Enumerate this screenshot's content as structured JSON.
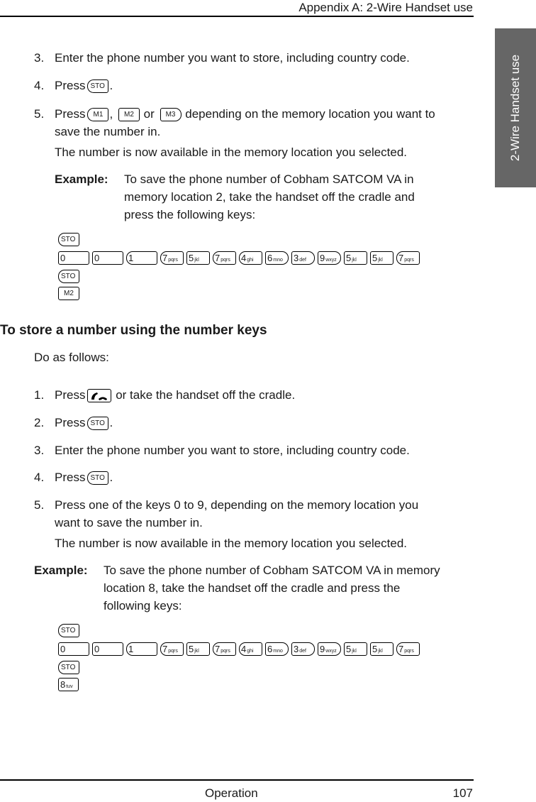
{
  "header": {
    "title": "Appendix A:  2-Wire Handset use"
  },
  "side_tab": {
    "label": "2-Wire Handset use",
    "color": "#666666"
  },
  "section1": {
    "steps": [
      {
        "num": "3.",
        "text": "Enter the phone number you want to store, including country code."
      },
      {
        "num": "4.",
        "pre": "Press",
        "post": "."
      },
      {
        "num": "5.",
        "pre": "Press",
        "sep1": ",",
        "sep2": "or",
        "post": "depending on the memory location you want to",
        "cont": "save the number in."
      }
    ],
    "note": "The number is now available in the memory location you selected.",
    "example": {
      "label": "Example:",
      "lines": [
        "To save the phone number of Cobham SATCOM VA in",
        "memory location 2, take the handset off the cradle and",
        "press the following keys:"
      ]
    }
  },
  "keys": {
    "sto": "STO",
    "m1": "M1",
    "m2": "M2",
    "m3": "M3",
    "number_sequence": [
      {
        "main": "0",
        "sub": ""
      },
      {
        "main": "0",
        "sub": ""
      },
      {
        "main": "1",
        "sub": ""
      },
      {
        "main": "7",
        "sub": "pqrs"
      },
      {
        "main": "5",
        "sub": "jkl"
      },
      {
        "main": "7",
        "sub": "pqrs"
      },
      {
        "main": "4",
        "sub": "ghi"
      },
      {
        "main": "6",
        "sub": "mno"
      },
      {
        "main": "3",
        "sub": "def"
      },
      {
        "main": "9",
        "sub": "wxyz"
      },
      {
        "main": "5",
        "sub": "jkl"
      },
      {
        "main": "5",
        "sub": "jkl"
      },
      {
        "main": "7",
        "sub": "pqrs"
      }
    ],
    "eight": {
      "main": "8",
      "sub": "tuv"
    },
    "offhook_icon": "handset-offhook-icon"
  },
  "section2": {
    "heading": "To store a number using the number keys",
    "intro": "Do as follows:",
    "steps": [
      {
        "num": "1.",
        "pre": "Press",
        "post": "or take the handset off the cradle."
      },
      {
        "num": "2.",
        "pre": "Press",
        "post": "."
      },
      {
        "num": "3.",
        "text": "Enter the phone number you want to store, including country code."
      },
      {
        "num": "4.",
        "pre": "Press",
        "post": "."
      },
      {
        "num": "5.",
        "text": "Press one of the keys 0 to 9, depending on the memory location you",
        "cont": "want to save the number in."
      }
    ],
    "note": "The number is now available in the memory location you selected.",
    "example": {
      "label": "Example:",
      "lines": [
        "To save the phone number of Cobham SATCOM VA in memory",
        "location 8, take the handset off the cradle and press the",
        "following keys:"
      ]
    }
  },
  "footer": {
    "section": "Operation",
    "page": "107"
  }
}
